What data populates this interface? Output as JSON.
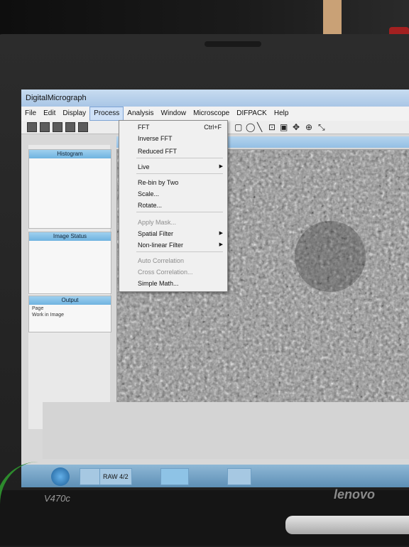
{
  "window": {
    "title": "DigitalMicrograph"
  },
  "menubar": [
    "File",
    "Edit",
    "Display",
    "Process",
    "Analysis",
    "Window",
    "Microscope",
    "DIFPACK",
    "Help"
  ],
  "active_menu": "Process",
  "process_menu": {
    "items": [
      {
        "label": "FFT",
        "shortcut": "Ctrl+F",
        "disabled": false,
        "submenu": false
      },
      {
        "label": "Inverse FFT",
        "disabled": false,
        "submenu": false
      },
      {
        "label": "Reduced FFT",
        "disabled": false,
        "submenu": false
      },
      {
        "label": "Live",
        "disabled": false,
        "submenu": true
      },
      {
        "label": "Re-bin by Two",
        "disabled": false,
        "submenu": false
      },
      {
        "label": "Scale...",
        "disabled": false,
        "submenu": false
      },
      {
        "label": "Rotate...",
        "disabled": false,
        "submenu": false
      },
      {
        "label": "Apply Mask...",
        "disabled": true,
        "submenu": false
      },
      {
        "label": "Spatial Filter",
        "disabled": false,
        "submenu": true
      },
      {
        "label": "Non-linear Filter",
        "disabled": false,
        "submenu": true
      },
      {
        "label": "Auto Correlation",
        "disabled": true,
        "submenu": false
      },
      {
        "label": "Cross Correlation...",
        "disabled": true,
        "submenu": false
      },
      {
        "label": "Simple Math...",
        "disabled": false,
        "submenu": false
      }
    ]
  },
  "panels": {
    "histogram": {
      "title": "Histogram"
    },
    "image_status": {
      "title": "Image Status"
    },
    "output": {
      "title": "Output",
      "lines": [
        "Page",
        "Work in Image"
      ]
    }
  },
  "taskbar": {
    "task_label": "RAW 4/2"
  },
  "laptop": {
    "model": "V470c",
    "brand": "lenovo"
  },
  "colors": {
    "titlebar": "#a9c6e6",
    "menu_highlight": "#cfe1f7",
    "panel_title": "#6fb3e0",
    "taskbar": "#5d8fb5"
  }
}
